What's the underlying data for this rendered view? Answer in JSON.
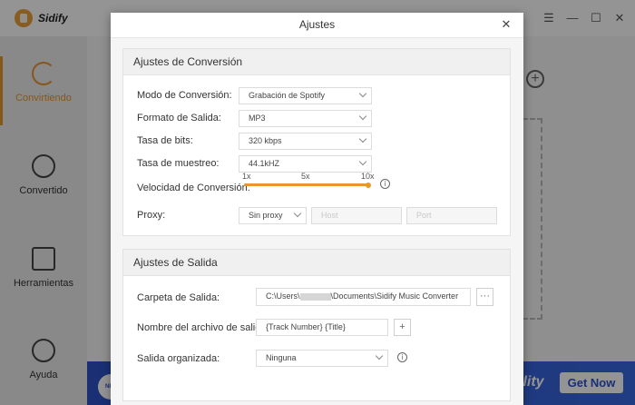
{
  "app": {
    "brand": "Sidify",
    "win_controls": {
      "a": "☰",
      "b": "—",
      "c": "☐",
      "d": "✕"
    }
  },
  "sidebar": {
    "items": [
      {
        "label": "Convirtiendo",
        "icon": "converting-icon"
      },
      {
        "label": "Convertido",
        "icon": "clock-icon"
      },
      {
        "label": "Herramientas",
        "icon": "toolbox-icon"
      },
      {
        "label": "Ayuda",
        "icon": "help-icon"
      }
    ]
  },
  "banner": {
    "badge": "NET",
    "text": "ility",
    "cta": "Get Now"
  },
  "dialog": {
    "title": "Ajustes",
    "close": "✕",
    "conversion": {
      "heading": "Ajustes de Conversión",
      "mode": {
        "label": "Modo de Conversión:",
        "value": "Grabación de Spotify"
      },
      "format": {
        "label": "Formato de Salida:",
        "value": "MP3"
      },
      "bitrate": {
        "label": "Tasa de bits:",
        "value": "320 kbps"
      },
      "samplerate": {
        "label": "Tasa de muestreo:",
        "value": "44.1kHZ"
      },
      "speed": {
        "label": "Velocidad de Conversión:",
        "ticks": [
          "1x",
          "5x",
          "10x"
        ],
        "value": "10x"
      },
      "proxy": {
        "label": "Proxy:",
        "value": "Sin proxy",
        "host_placeholder": "Host",
        "port_placeholder": "Port"
      }
    },
    "output": {
      "heading": "Ajustes de Salida",
      "folder": {
        "label": "Carpeta de Salida:",
        "value_a": "C:\\Users\\",
        "value_b": "\\Documents\\Sidify Music Converter",
        "browse": "···"
      },
      "filename": {
        "label": "Nombre del archivo de salida:",
        "value": "{Track Number} {Title}",
        "add": "+"
      },
      "organized": {
        "label": "Salida organizada:",
        "value": "Ninguna"
      }
    }
  }
}
